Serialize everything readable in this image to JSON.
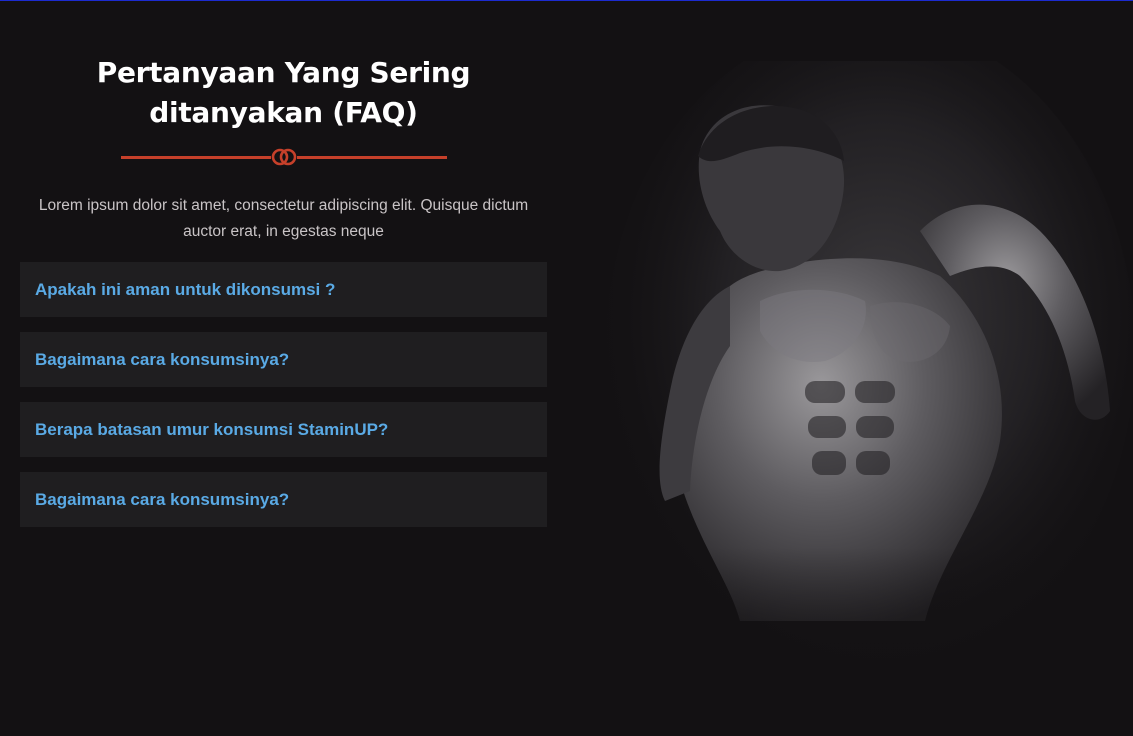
{
  "faq": {
    "title_line1": "Pertanyaan Yang Sering",
    "title_line2": "ditanyakan (FAQ)",
    "intro_line1": "Lorem ipsum dolor sit amet, consectetur adipiscing elit. Quisque dictum",
    "intro_line2": "auctor erat, in egestas neque",
    "items": [
      {
        "question": "Apakah ini aman untuk dikonsumsi ?"
      },
      {
        "question": "Bagaimana cara konsumsinya?"
      },
      {
        "question": "Berapa batasan umur konsumsi StaminUP?"
      },
      {
        "question": "Bagaimana cara konsumsinya?"
      }
    ]
  },
  "colors": {
    "background": "#131113",
    "accent": "#c6402a",
    "question_text": "#5aaae5",
    "item_background": "#1f1e20",
    "top_border": "#1c2bd0"
  },
  "icons": {
    "divider": "interlocked-rings-icon"
  }
}
